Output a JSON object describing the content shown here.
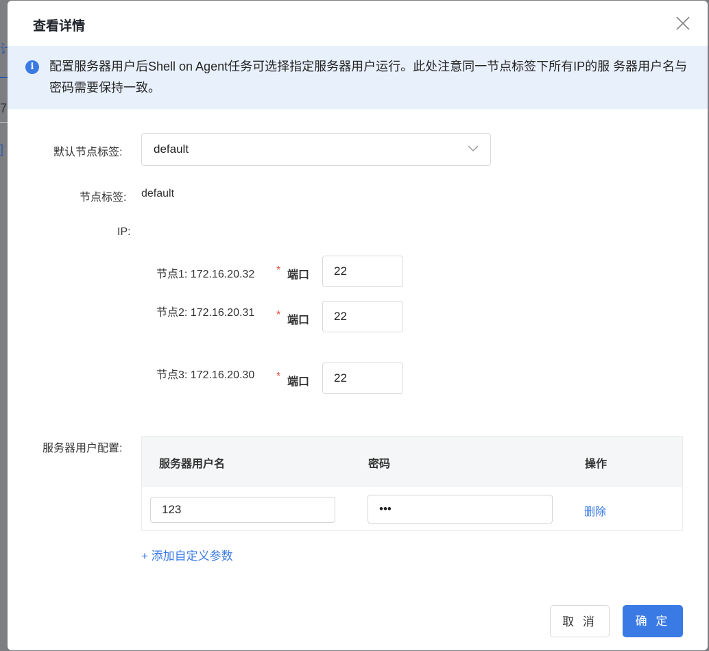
{
  "background": {
    "frag1": "计",
    "frag2": "7",
    "frag3": "]"
  },
  "modal": {
    "title": "查看详情",
    "close_icon": "close-icon",
    "notice": {
      "icon": "i",
      "text": "配置服务器用户后Shell on Agent任务可选择指定服务器用户运行。此处注意同一节点标签下所有IP的服 务器用户名与密码需要保持一致。"
    },
    "default_tag": {
      "label": "默认节点标签:",
      "value": "default"
    },
    "node_tag": {
      "label": "节点标签:",
      "value": "default"
    },
    "ip": {
      "label": "IP:",
      "port_label": "端口",
      "nodes": [
        {
          "label": "节点1: 172.16.20.32",
          "port": "22"
        },
        {
          "label": "节点2: 172.16.20.31",
          "port": "22"
        },
        {
          "label": "节点3: 172.16.20.30",
          "port": "22"
        }
      ]
    },
    "server_user": {
      "label": "服务器用户配置:",
      "columns": [
        "服务器用户名",
        "密码",
        "操作"
      ],
      "rows": [
        {
          "username": "123",
          "password": "•••",
          "action": "删除"
        }
      ],
      "add_label": "+ 添加自定义参数"
    },
    "buttons": {
      "cancel": "取 消",
      "ok": "确 定"
    }
  },
  "colors": {
    "accent": "#3a7ae5",
    "notice_bg": "#e8f0fc",
    "required": "#e0493c"
  }
}
